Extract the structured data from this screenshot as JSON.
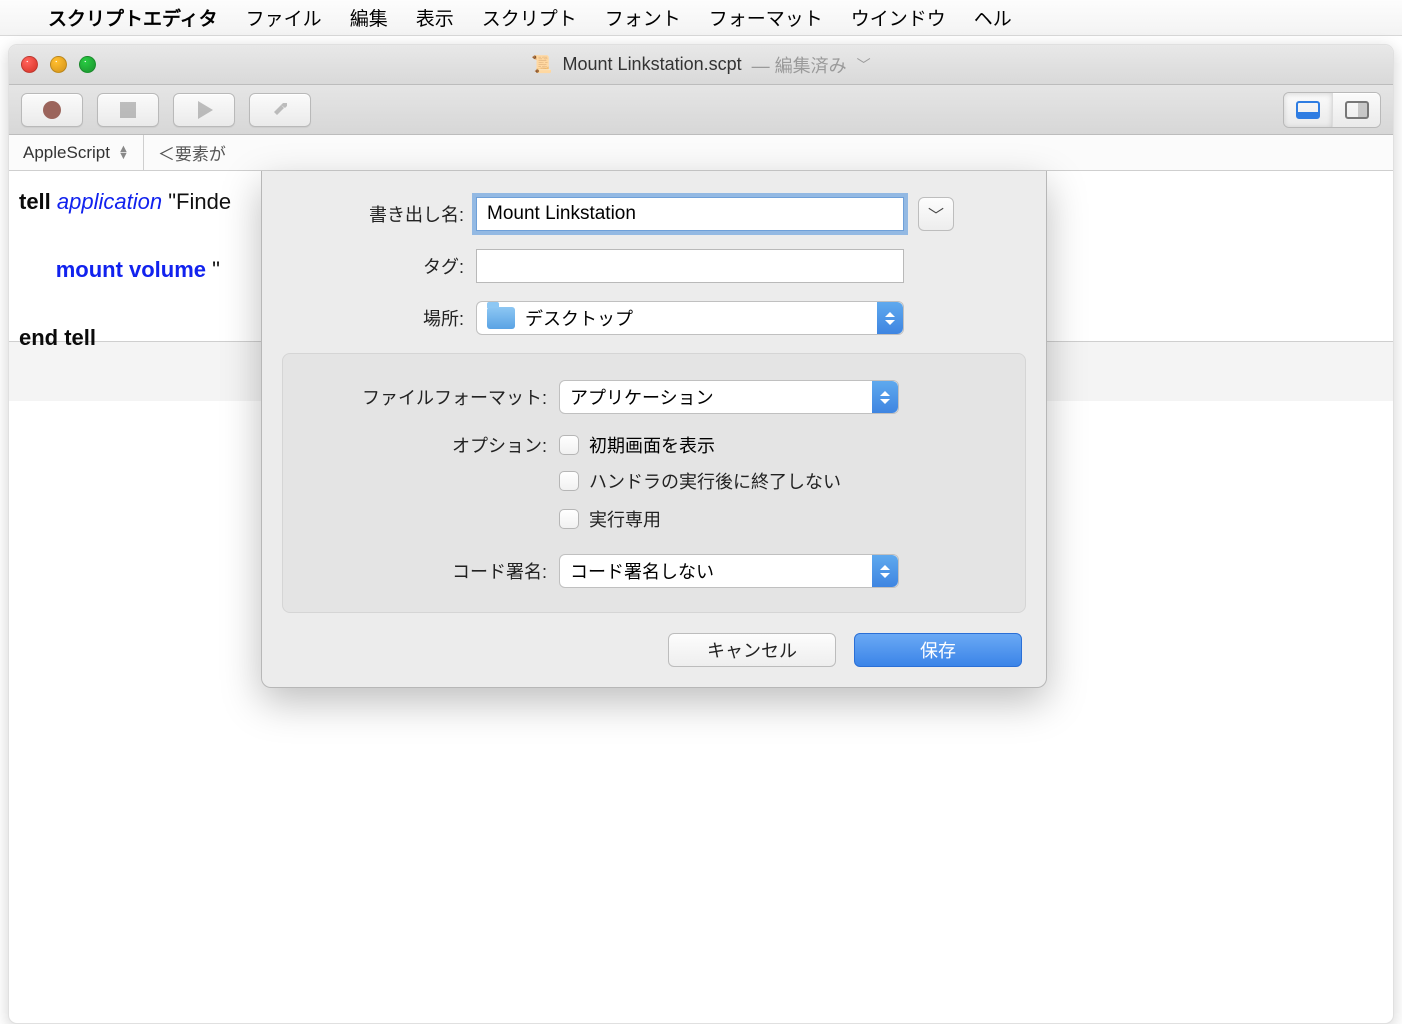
{
  "menubar": {
    "app": "スクリプトエディタ",
    "items": [
      "ファイル",
      "編集",
      "表示",
      "スクリプト",
      "フォント",
      "フォーマット",
      "ウインドウ",
      "ヘル"
    ]
  },
  "window": {
    "filename": "Mount Linkstation.scpt",
    "state": "— 編集済み"
  },
  "editor_header": {
    "language": "AppleScript",
    "crumb": "＜要素が"
  },
  "code": {
    "l1_kw": "tell",
    "l1_arg": "application",
    "l1_str": "\"Finde",
    "l2_kw": "mount volume",
    "l2_rest": " \"",
    "l3_kw": "end tell"
  },
  "sheet": {
    "labels": {
      "name": "書き出し名:",
      "tags": "タグ:",
      "where": "場所:",
      "format": "ファイルフォーマット:",
      "options": "オプション:",
      "codesign": "コード署名:"
    },
    "name_value": "Mount Linkstation",
    "where_value": "デスクトップ",
    "format_value": "アプリケーション",
    "option_items": [
      "初期画面を表示",
      "ハンドラの実行後に終了しない",
      "実行専用"
    ],
    "codesign_value": "コード署名しない",
    "buttons": {
      "cancel": "キャンセル",
      "save": "保存"
    }
  }
}
